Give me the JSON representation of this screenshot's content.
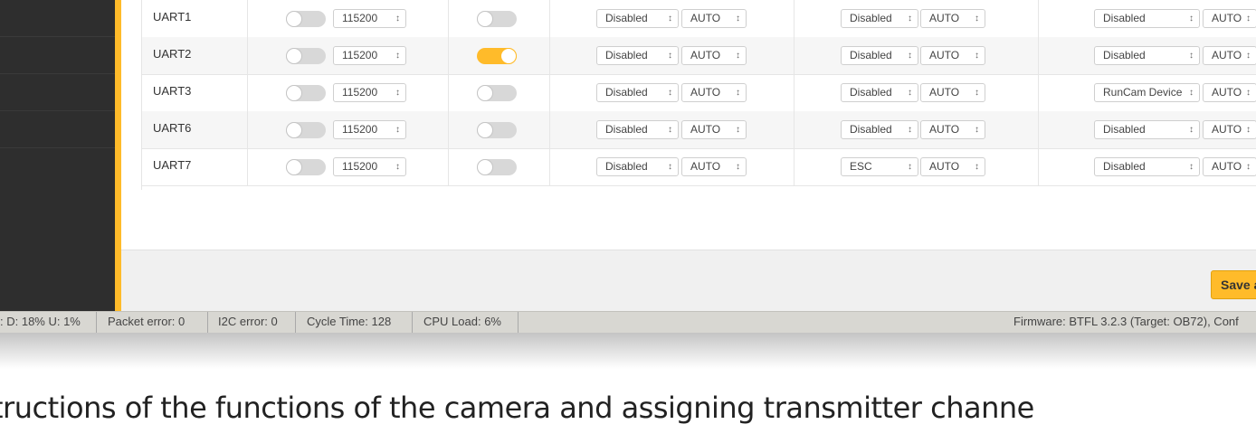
{
  "ports_table": {
    "rows": [
      {
        "name": "UART1",
        "msp_enabled": false,
        "msp_baud": "115200",
        "serial_rx": false,
        "telemetry": "Disabled",
        "telemetry_baud": "AUTO",
        "sensor": "Disabled",
        "sensor_baud": "AUTO",
        "peripherals": "Disabled",
        "peripherals_baud": "AUTO"
      },
      {
        "name": "UART2",
        "msp_enabled": false,
        "msp_baud": "115200",
        "serial_rx": true,
        "telemetry": "Disabled",
        "telemetry_baud": "AUTO",
        "sensor": "Disabled",
        "sensor_baud": "AUTO",
        "peripherals": "Disabled",
        "peripherals_baud": "AUTO"
      },
      {
        "name": "UART3",
        "msp_enabled": false,
        "msp_baud": "115200",
        "serial_rx": false,
        "telemetry": "Disabled",
        "telemetry_baud": "AUTO",
        "sensor": "Disabled",
        "sensor_baud": "AUTO",
        "peripherals": "RunCam Device",
        "peripherals_baud": "AUTO"
      },
      {
        "name": "UART6",
        "msp_enabled": false,
        "msp_baud": "115200",
        "serial_rx": false,
        "telemetry": "Disabled",
        "telemetry_baud": "AUTO",
        "sensor": "Disabled",
        "sensor_baud": "AUTO",
        "peripherals": "Disabled",
        "peripherals_baud": "AUTO"
      },
      {
        "name": "UART7",
        "msp_enabled": false,
        "msp_baud": "115200",
        "serial_rx": false,
        "telemetry": "Disabled",
        "telemetry_baud": "AUTO",
        "sensor": "ESC",
        "sensor_baud": "AUTO",
        "peripherals": "Disabled",
        "peripherals_baud": "AUTO"
      }
    ]
  },
  "toolbar": {
    "save_label": "Save a"
  },
  "status_bar": {
    "usage": ": D: 18% U: 1%",
    "packet_error": "Packet error: 0",
    "i2c_error": "I2C error: 0",
    "cycle_time": "Cycle Time: 128",
    "cpu_load": "CPU Load: 6%",
    "firmware": "Firmware: BTFL 3.2.3 (Target: OB72), Conf"
  },
  "caption": "tructions of the functions of the camera and assigning transmitter channe",
  "icons": {
    "select_arrow": "select-arrow-icon"
  },
  "colors": {
    "accent": "#ffbb2a",
    "sidebar": "#2e2e2e",
    "status_bar": "#d8d7d2"
  }
}
